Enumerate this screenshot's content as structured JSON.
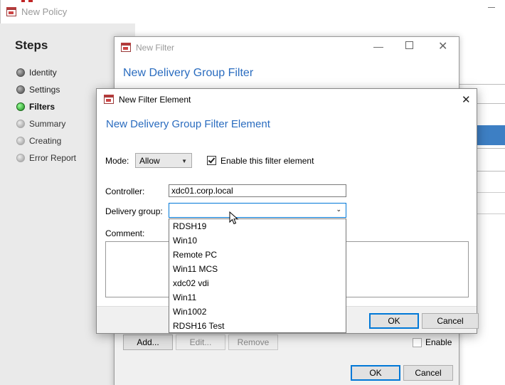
{
  "main_window": {
    "title": "New Policy",
    "steps_title": "Steps",
    "steps": [
      {
        "label": "Identity",
        "state": "done"
      },
      {
        "label": "Settings",
        "state": "done"
      },
      {
        "label": "Filters",
        "state": "active"
      },
      {
        "label": "Summary",
        "state": "future"
      },
      {
        "label": "Creating",
        "state": "future"
      },
      {
        "label": "Error Report",
        "state": "future"
      }
    ]
  },
  "filter_window": {
    "title": "New Filter",
    "heading": "New Delivery Group Filter",
    "buttons": {
      "add": "Add...",
      "edit": "Edit...",
      "remove": "Remove",
      "ok": "OK",
      "cancel": "Cancel"
    },
    "enable_label": "Enable"
  },
  "element_dialog": {
    "title": "New Filter Element",
    "heading": "New Delivery Group Filter Element",
    "mode_label": "Mode:",
    "mode_value": "Allow",
    "enable_label": "Enable this filter element",
    "enable_checked": true,
    "controller_label": "Controller:",
    "controller_value": "xdc01.corp.local",
    "delivery_group_label": "Delivery group:",
    "delivery_group_value": "",
    "comment_label": "Comment:",
    "ok_label": "OK",
    "cancel_label": "Cancel",
    "delivery_group_options": [
      "RDSH19",
      "Win10",
      "Remote PC",
      "Win11 MCS",
      "xdc02 vdi",
      "Win11",
      "Win1002",
      "RDSH16 Test"
    ]
  },
  "colors": {
    "heading_blue": "#2a6cbf",
    "accent_blue": "#0078d7",
    "active_step": "#1a8a1a"
  }
}
